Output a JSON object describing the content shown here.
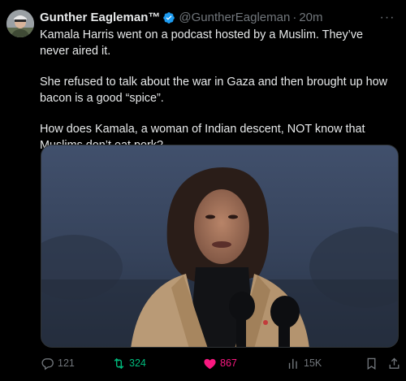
{
  "tweet": {
    "author_name": "Gunther Eagleman™",
    "author_handle": "@GuntherEagleman",
    "separator": "·",
    "time": "20m",
    "more_label": "···",
    "paragraphs": [
      "Kamala Harris went on a podcast hosted by a Muslim. They’ve never aired it.",
      "She refused to talk about the war in Gaza and then brought up how bacon is a good “spice”.",
      "How does Kamala, a woman of Indian descent, NOT know that Muslims don’t eat pork?"
    ],
    "icons": {
      "verified": "verified-badge-icon",
      "more": "more-dots-icon",
      "reply": "reply-icon",
      "retweet": "retweet-icon",
      "like": "heart-icon",
      "views": "views-bar-chart-icon",
      "bookmark": "bookmark-icon",
      "share": "share-icon"
    },
    "stats": {
      "replies": "121",
      "retweets": "324",
      "likes": "867",
      "views": "15K"
    }
  },
  "colors": {
    "background": "#000000",
    "text": "#e7e9ea",
    "secondary": "#71767b",
    "verified_blue": "#1d9bf0",
    "retweet_green": "#00ba7c",
    "like_pink": "#f91880"
  }
}
